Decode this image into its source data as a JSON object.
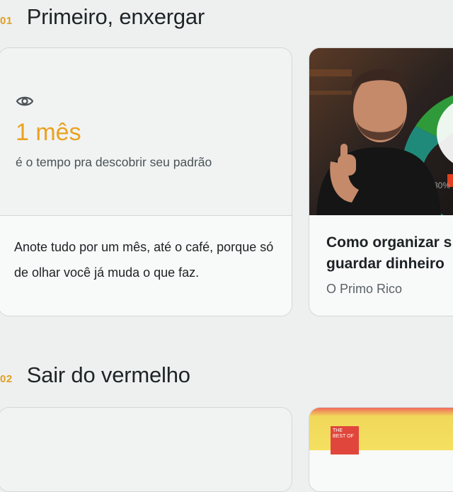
{
  "sections": [
    {
      "number": "01",
      "title": "Primeiro, enxergar",
      "stat": {
        "icon": "eye-icon",
        "value": "1 mês",
        "caption": "é o tempo pra descobrir seu padrão",
        "body": "Anote tudo por um mês, até o café, porque só de olhar você já muda o que faz."
      },
      "video": {
        "title_line1": "Como organizar s",
        "title_line2": "guardar dinheiro",
        "channel": "O Primo Rico",
        "thumb_badge": "30%"
      }
    },
    {
      "number": "02",
      "title": "Sair do vermelho",
      "video": {
        "thumb_text": "THE BEST OF"
      }
    }
  ],
  "colors": {
    "accent": "#eaa21f",
    "background": "#eef0f0"
  }
}
